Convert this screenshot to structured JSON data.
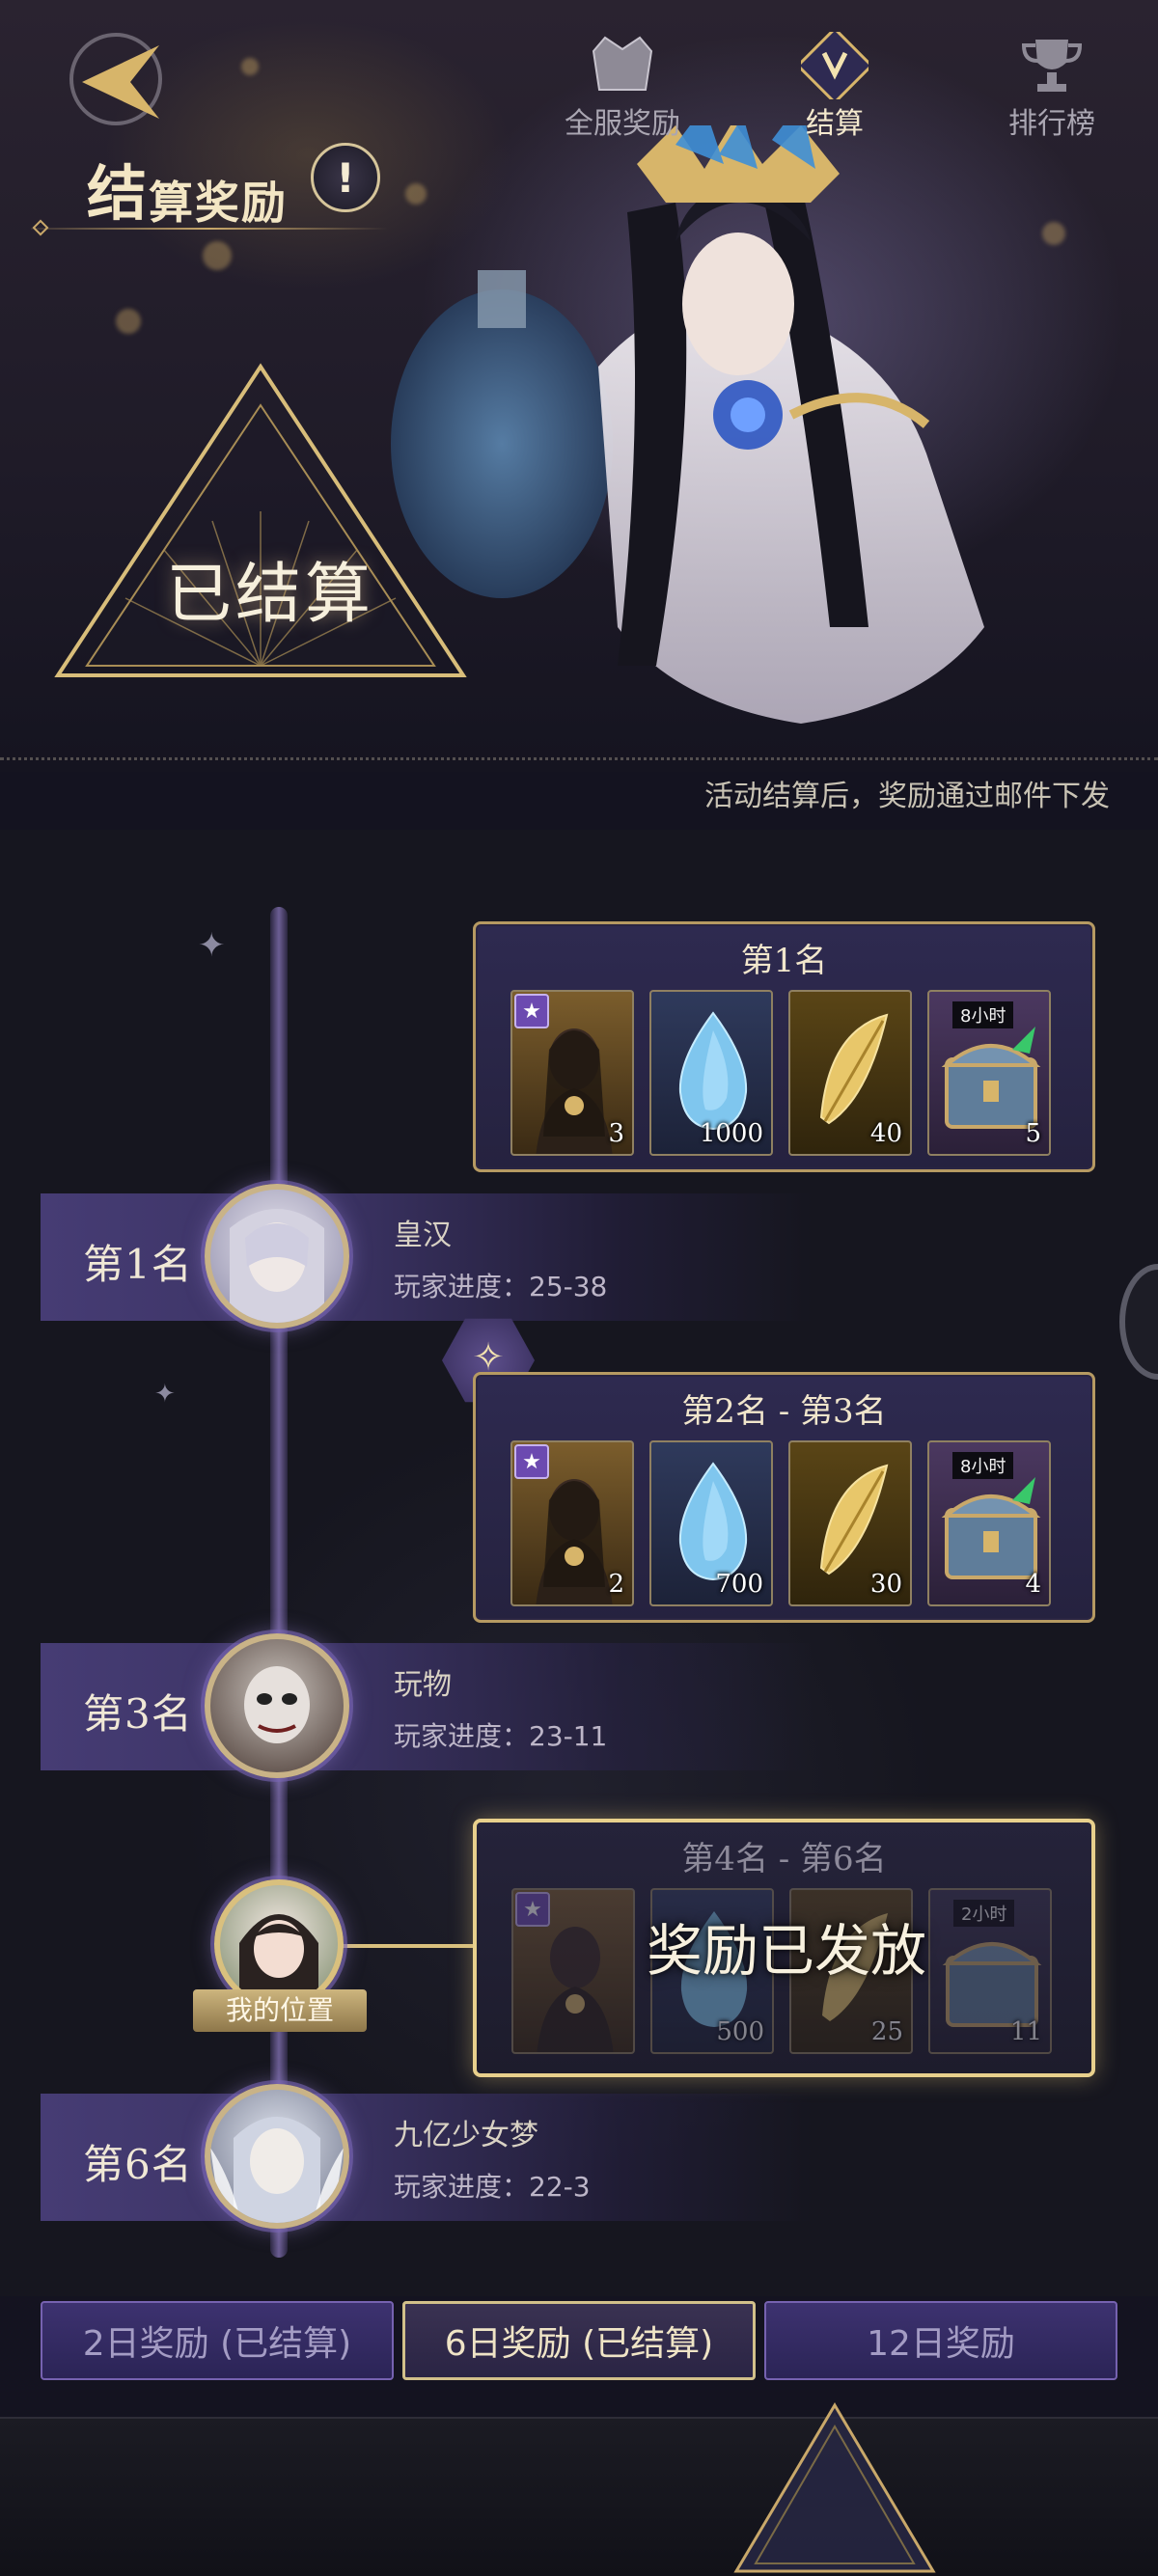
{
  "header": {
    "title_big": "结",
    "title_rest": "算奖励",
    "info_icon": "!",
    "settled_label": "已结算",
    "mail_note": "活动结算后，奖励通过邮件下发"
  },
  "ranks": [
    {
      "label": "第1名",
      "name": "皇汉",
      "progress": "玩家进度：25-38"
    },
    {
      "label": "第3名",
      "name": "玩物",
      "progress": "玩家进度：23-11"
    },
    {
      "label": "第6名",
      "name": "九亿少女梦",
      "progress": "玩家进度：22-3"
    }
  ],
  "reward_tiers": [
    {
      "title": "第1名",
      "items": [
        {
          "icon": "hero-card-icon",
          "qty": "3"
        },
        {
          "icon": "blue-gem-icon",
          "qty": "1000"
        },
        {
          "icon": "gold-feather-icon",
          "qty": "40"
        },
        {
          "icon": "treasure-chest-icon",
          "qty": "5",
          "tag": "8小时"
        }
      ]
    },
    {
      "title": "第2名 - 第3名",
      "items": [
        {
          "icon": "hero-card-icon",
          "qty": "2"
        },
        {
          "icon": "blue-gem-icon",
          "qty": "700"
        },
        {
          "icon": "gold-feather-icon",
          "qty": "30"
        },
        {
          "icon": "treasure-chest-icon",
          "qty": "4",
          "tag": "8小时"
        }
      ]
    },
    {
      "title": "第4名 - 第6名",
      "items": [
        {
          "icon": "hero-card-icon",
          "qty": ""
        },
        {
          "icon": "blue-gem-icon",
          "qty": "500"
        },
        {
          "icon": "gold-feather-icon",
          "qty": "25"
        },
        {
          "icon": "treasure-chest-icon",
          "qty": "11",
          "tag": "2小时"
        }
      ],
      "stamp": "奖励已发放"
    }
  ],
  "my_position_label": "我的位置",
  "day_tabs": [
    {
      "label": "2日奖励 (已结算)",
      "active": false
    },
    {
      "label": "6日奖励 (已结算)",
      "active": true
    },
    {
      "label": "12日奖励",
      "active": false
    }
  ],
  "bottom_nav": [
    {
      "label": "",
      "icon": "back-arrow-icon"
    },
    {
      "label": "全服奖励",
      "icon": "crown-shield-icon"
    },
    {
      "label": "结算",
      "icon": "settlement-emblem-icon",
      "active": true
    },
    {
      "label": "排行榜",
      "icon": "trophy-icon"
    }
  ],
  "colors": {
    "gold": "#c9a86a",
    "purple_bar": "#463c74",
    "panel_bg": "#2e2a50",
    "background": "#16161f"
  }
}
